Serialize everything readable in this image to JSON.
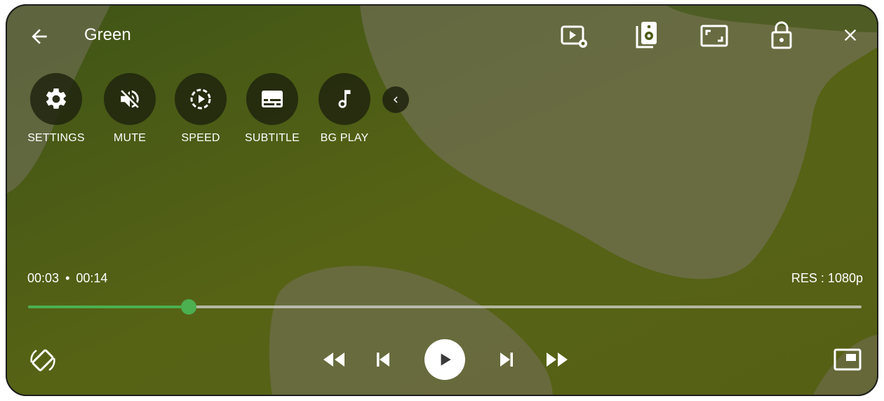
{
  "header": {
    "title": "Green"
  },
  "quick_actions": [
    {
      "label": "SETTINGS",
      "icon": "gear-icon"
    },
    {
      "label": "MUTE",
      "icon": "volume-off-icon"
    },
    {
      "label": "SPEED",
      "icon": "speed-icon"
    },
    {
      "label": "SUBTITLE",
      "icon": "subtitle-icon"
    },
    {
      "label": "BG PLAY",
      "icon": "music-note-icon"
    }
  ],
  "playback": {
    "current_time": "00:03",
    "separator": "•",
    "duration": "00:14",
    "resolution": "RES : 1080p",
    "progress_fraction": 0.193
  },
  "colors": {
    "accent": "#4caf50",
    "background": "#4d5a15"
  }
}
